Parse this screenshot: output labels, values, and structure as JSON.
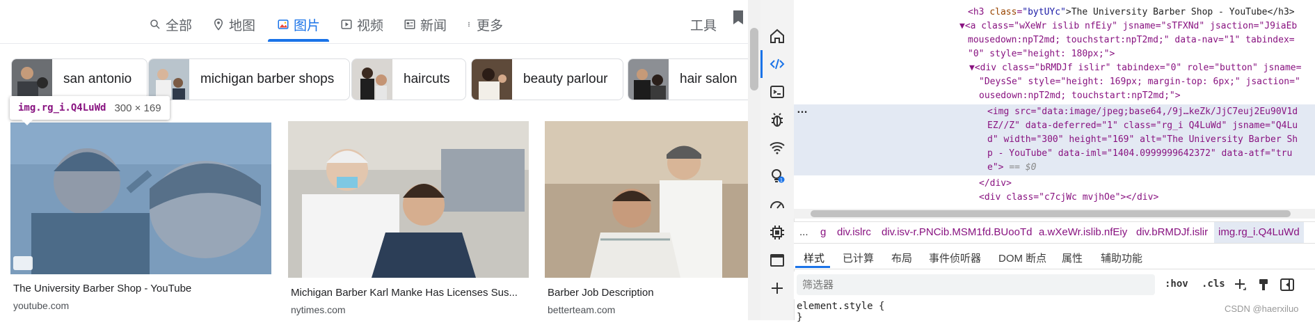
{
  "search": {
    "tabs": [
      {
        "label": "全部",
        "icon": "search-icon"
      },
      {
        "label": "地图",
        "icon": "map-pin-icon"
      },
      {
        "label": "图片",
        "icon": "image-icon",
        "active": true
      },
      {
        "label": "视频",
        "icon": "play-icon"
      },
      {
        "label": "新闻",
        "icon": "news-icon"
      },
      {
        "label": "更多",
        "icon": "more-vertical-icon"
      }
    ],
    "tools_label": "工具",
    "chips": [
      "san antonio",
      "michigan barber shops",
      "haircuts",
      "beauty parlour",
      "hair salon"
    ],
    "tooltip": {
      "selector": "img.rg_i.Q4LuWd",
      "dims": "300 × 169"
    },
    "results": [
      {
        "title": "The University Barber Shop - YouTube",
        "source": "youtube.com"
      },
      {
        "title": "Michigan Barber Karl Manke Has Licenses Sus...",
        "source": "nytimes.com"
      },
      {
        "title": "Barber Job Description",
        "source": "betterteam.com"
      }
    ],
    "accent_color": "#1a73e8"
  },
  "devtools": {
    "elements": {
      "h3": {
        "open": "<h3 ",
        "attr": "class",
        "value": "\"bytUYc\"",
        "text": ">The University Barber Shop - YouTube</h3>"
      },
      "a_line1": "▼<a class=\"wXeWr islib nfEiy\" jsname=\"sTFXNd\" jsaction=\"J9iaEb",
      "a_line2": "mousedown:npT2md; touchstart:npT2md;\" data-nav=\"1\" tabindex=",
      "a_line3": "\"0\" style=\"height: 180px;\">",
      "div_line1": "▼<div class=\"bRMDJf islir\" tabindex=\"0\" role=\"button\" jsname=",
      "div_line2": "\"DeysSe\" style=\"height: 169px; margin-top: 6px;\" jsaction=\"",
      "div_line3": "ousedown:npT2md; touchstart:npT2md;\">",
      "img_line1": "<img src=\"data:image/jpeg;base64,/9j…keZk/JjC7euj2Eu90V1d",
      "img_line2": "EZ//Z\" data-deferred=\"1\" class=\"rg_i Q4LuWd\" jsname=\"Q4Lu",
      "img_line3": "d\" width=\"300\" height=\"169\" alt=\"The University Barber Sh",
      "img_line4": "p - YouTube\" data-iml=\"1404.0999999642372\" data-atf=\"tru",
      "img_line5": "e\">",
      "eq": "== $0",
      "close_div": "</div>",
      "next_div": "<div class=\"c7cjWc mvjhOe\"></div>"
    },
    "breadcrumbs": [
      "...",
      "g",
      "div.islrc",
      "div.isv-r.PNCib.MSM1fd.BUooTd",
      "a.wXeWr.islib.nfEiy",
      "div.bRMDJf.islir",
      "img.rg_i.Q4LuWd"
    ],
    "style_tabs": [
      "样式",
      "已计算",
      "布局",
      "事件侦听器",
      "DOM 断点",
      "属性",
      "辅助功能"
    ],
    "filter_placeholder": "筛选器",
    "filter_tools": [
      ":hov",
      ".cls"
    ],
    "style_rule": "element.style {",
    "style_rule_close": "}",
    "dots": "…"
  },
  "watermark": "CSDN @haerxiluo"
}
